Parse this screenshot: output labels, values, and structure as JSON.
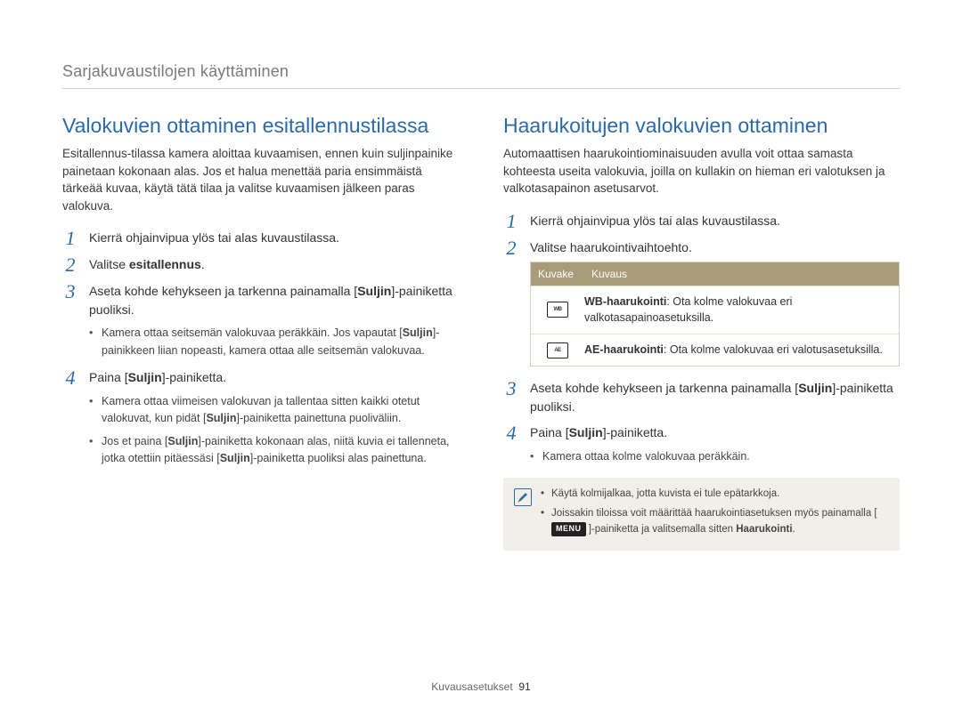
{
  "breadcrumb": "Sarjakuvaustilojen käyttäminen",
  "footer": {
    "label": "Kuvausasetukset",
    "page": "91"
  },
  "left": {
    "title": "Valokuvien ottaminen esitallennustilassa",
    "intro": "Esitallennus-tilassa kamera aloittaa kuvaamisen, ennen kuin suljinpainike painetaan kokonaan alas. Jos et halua menettää paria ensimmäistä tärkeää kuvaa, käytä tätä tilaa ja valitse kuvaamisen jälkeen paras valokuva.",
    "steps": {
      "s1": "Kierrä ohjainvipua ylös tai alas kuvaustilassa.",
      "s2_pre": "Valitse ",
      "s2_strong": "esitallennus",
      "s2_post": ".",
      "s3_pre": "Aseta kohde kehykseen ja tarkenna painamalla [",
      "s3_strong": "Suljin",
      "s3_post": "]-painiketta puoliksi.",
      "s3_b1_pre": "Kamera ottaa seitsemän valokuvaa peräkkäin. Jos vapautat [",
      "s3_b1_strong": "Suljin",
      "s3_b1_post": "]-painikkeen liian nopeasti, kamera ottaa alle seitsemän valokuvaa.",
      "s4_pre": "Paina [",
      "s4_strong": "Suljin",
      "s4_post": "]-painiketta.",
      "s4_b1_pre": "Kamera ottaa viimeisen valokuvan ja tallentaa sitten kaikki otetut valokuvat, kun pidät [",
      "s4_b1_strong": "Suljin",
      "s4_b1_post": "]-painiketta painettuna puoliväliin.",
      "s4_b2_a": "Jos et paina [",
      "s4_b2_b": "Suljin",
      "s4_b2_c": "]-painiketta kokonaan alas, niitä kuvia ei tallenneta, jotka otettiin pitäessäsi [",
      "s4_b2_d": "Suljin",
      "s4_b2_e": "]-painiketta puoliksi alas painettuna."
    }
  },
  "right": {
    "title": "Haarukoitujen valokuvien ottaminen",
    "intro": "Automaattisen haarukointiominaisuuden avulla voit ottaa samasta kohteesta useita valokuvia, joilla on kullakin on hieman eri valotuksen ja valkotasapainon asetusarvot.",
    "steps": {
      "s1": "Kierrä ohjainvipua ylös tai alas kuvaustilassa.",
      "s2": "Valitse haarukointivaihtoehto.",
      "s3_pre": "Aseta kohde kehykseen ja tarkenna painamalla [",
      "s3_strong": "Suljin",
      "s3_post": "]-painiketta puoliksi.",
      "s4_pre": "Paina [",
      "s4_strong": "Suljin",
      "s4_post": "]-painiketta.",
      "s4_b1": "Kamera ottaa kolme valokuvaa peräkkäin."
    },
    "table": {
      "head_a": "Kuvake",
      "head_b": "Kuvaus",
      "rows": [
        {
          "icon": "WB",
          "strong": "WB-haarukointi",
          "text": ": Ota kolme valokuvaa eri valkotasapainoasetuksilla."
        },
        {
          "icon": "AE",
          "strong": "AE-haarukointi",
          "text": ": Ota kolme valokuvaa eri valotusasetuksilla."
        }
      ]
    },
    "note": {
      "n1": "Käytä kolmijalkaa, jotta kuvista ei tule epätarkkoja.",
      "n2_pre": "Joissakin tiloissa voit määrittää  haarukointiasetuksen myös painamalla [ ",
      "n2_badge": "MENU",
      "n2_mid": " ]-painiketta ja valitsemalla sitten ",
      "n2_strong": "Haarukointi",
      "n2_post": "."
    }
  }
}
